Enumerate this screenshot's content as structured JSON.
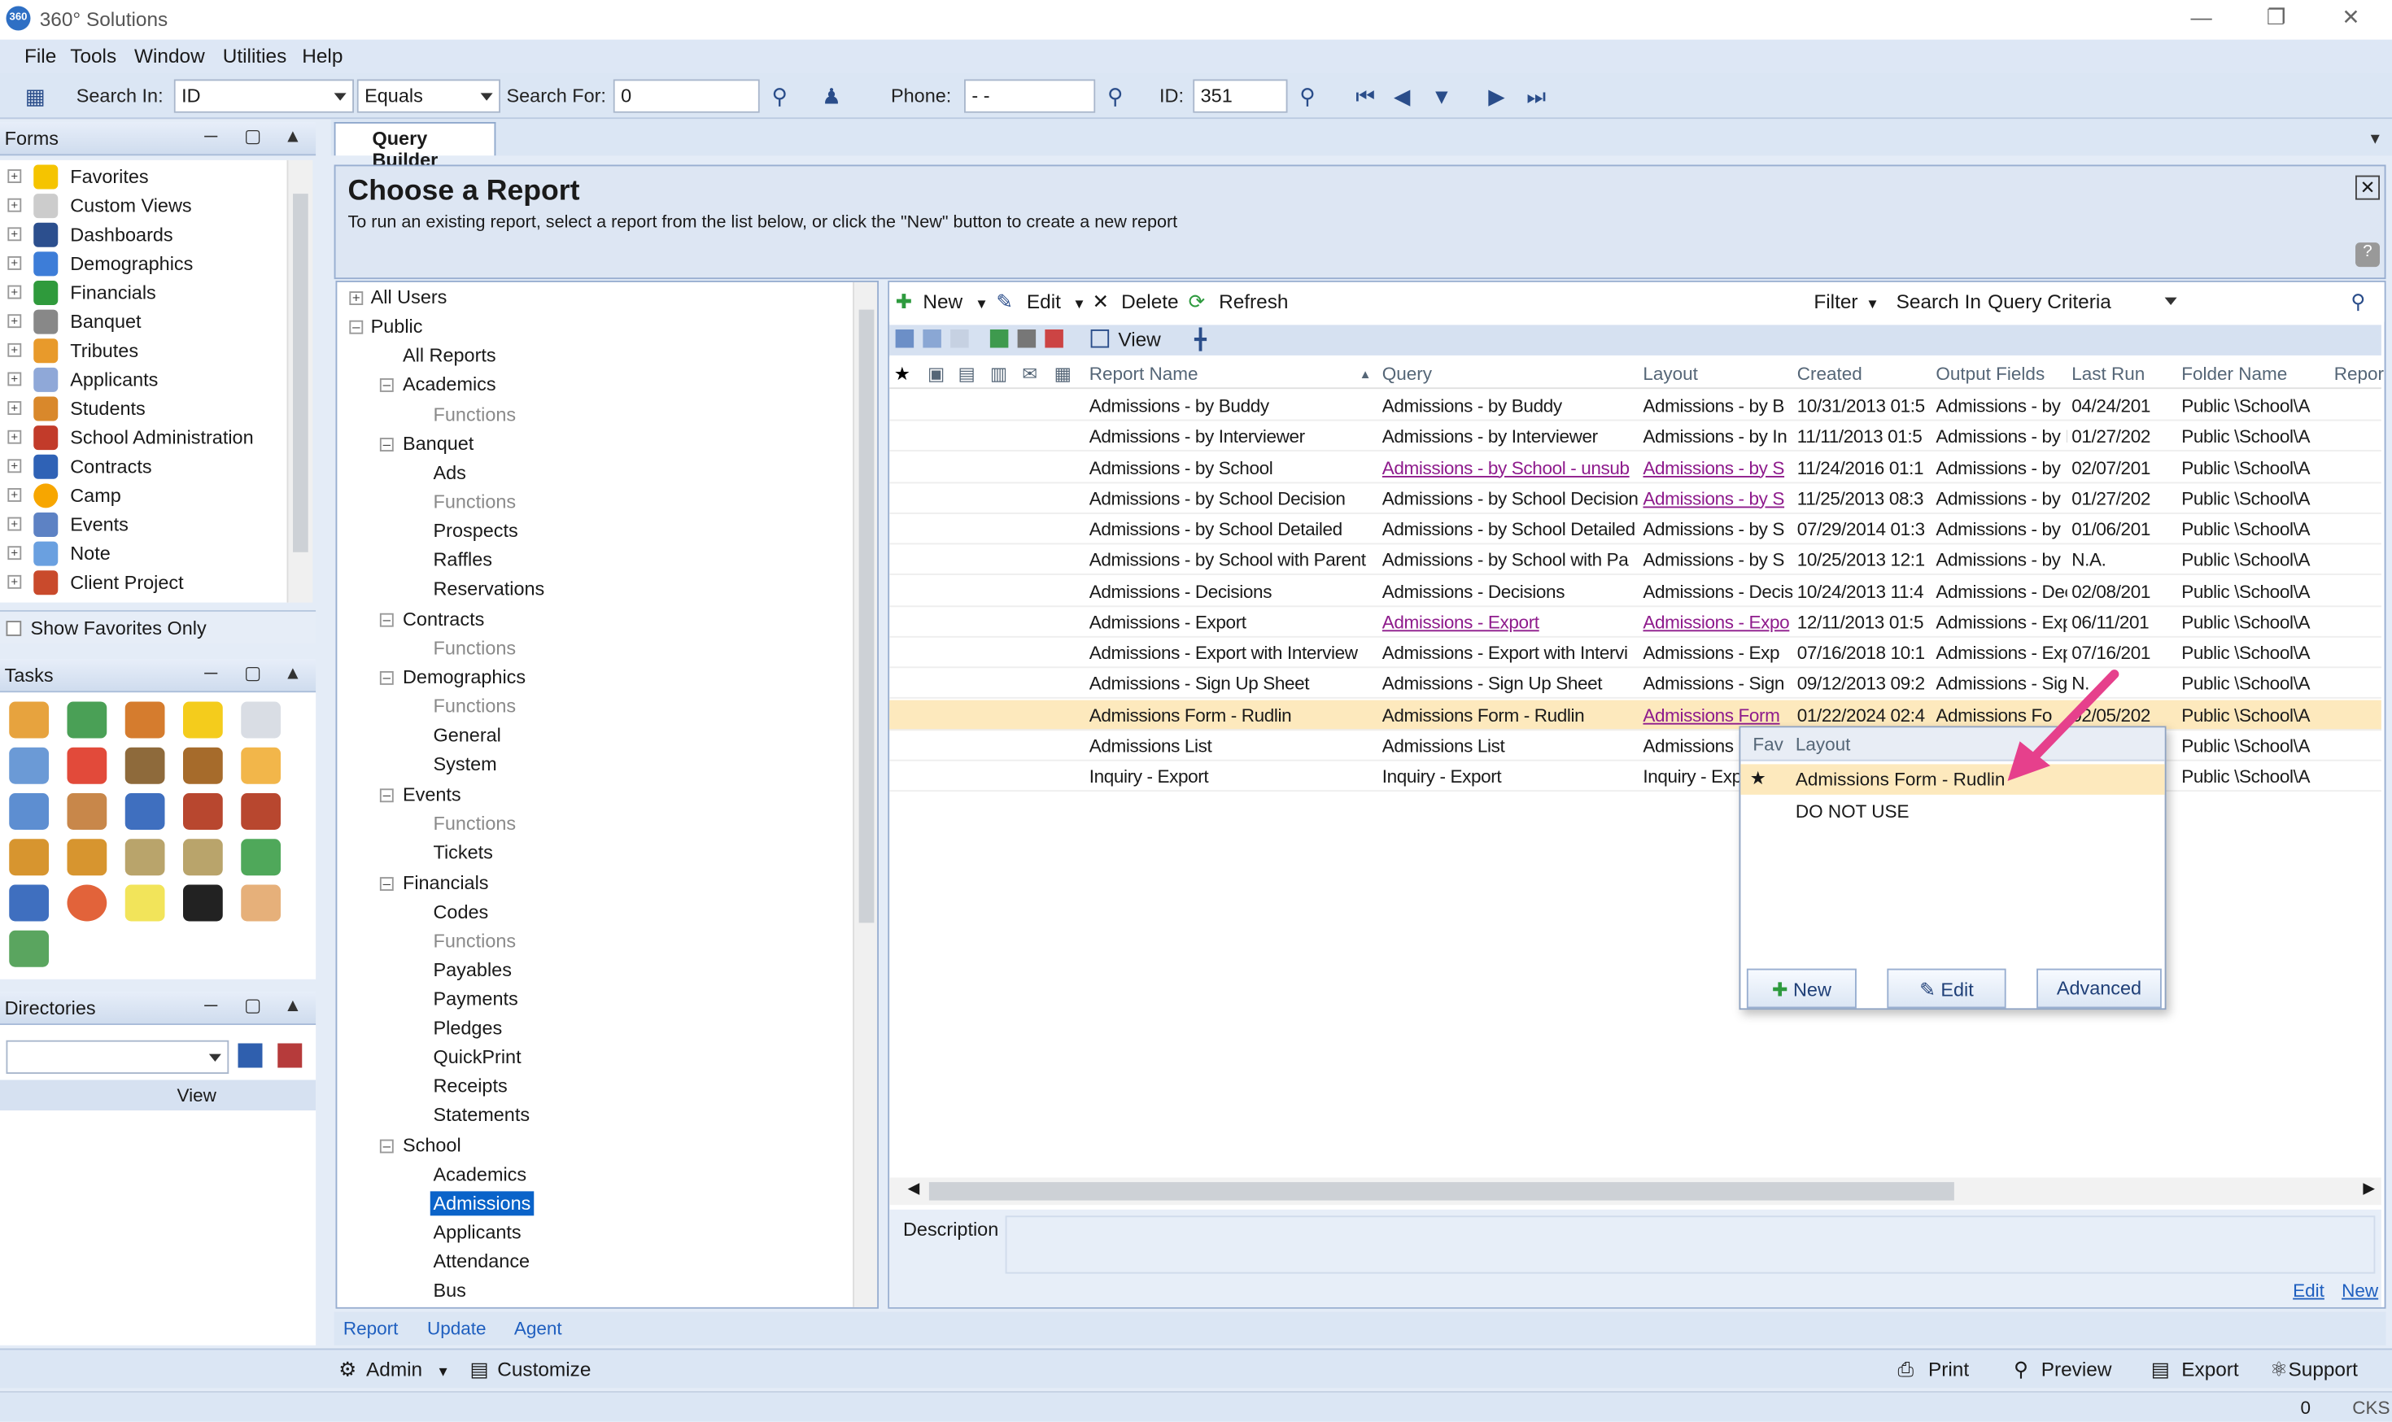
{
  "window": {
    "title": "360° Solutions"
  },
  "menu": [
    "File",
    "Tools",
    "Window",
    "Utilities",
    "Help"
  ],
  "toolbar": {
    "search_in_label": "Search In:",
    "search_in_value": "ID",
    "op_value": "Equals",
    "search_for_label": "Search For:",
    "search_for_value": "0",
    "phone_label": "Phone:",
    "phone_value": "-   -",
    "id_label": "ID:",
    "id_value": "351"
  },
  "forms": {
    "title": "Forms",
    "items": [
      "Favorites",
      "Custom Views",
      "Dashboards",
      "Demographics",
      "Financials",
      "Banquet",
      "Tributes",
      "Applicants",
      "Students",
      "School Administration",
      "Contracts",
      "Camp",
      "Events",
      "Note",
      "Client Project"
    ],
    "show_favorites": "Show Favorites Only"
  },
  "tasks": {
    "title": "Tasks"
  },
  "directories": {
    "title": "Directories",
    "view": "View"
  },
  "tab": {
    "label": "Query Builder"
  },
  "header": {
    "title": "Choose a Report",
    "subtitle": "To run an existing report, select a report from the list below, or click the \"New\" button to create a new report"
  },
  "tree": [
    "All Users",
    "Public",
    "All Reports",
    "Academics",
    "Functions",
    "Banquet",
    "Ads",
    "Functions",
    "Prospects",
    "Raffles",
    "Reservations",
    "Contracts",
    "Functions",
    "Demographics",
    "Functions",
    "General",
    "System",
    "Events",
    "Functions",
    "Tickets",
    "Financials",
    "Codes",
    "Functions",
    "Payables",
    "Payments",
    "Pledges",
    "QuickPrint",
    "Receipts",
    "Statements",
    "School",
    "Academics",
    "Admissions",
    "Applicants",
    "Attendance",
    "Bus"
  ],
  "grid_toolbar": {
    "new": "New",
    "edit": "Edit",
    "delete": "Delete",
    "refresh": "Refresh",
    "filter": "Filter",
    "search_in": "Search In",
    "criteria": "Query Criteria",
    "view": "View"
  },
  "columns": [
    "Report Name",
    "Query",
    "Layout",
    "Created",
    "Output Fields",
    "Last Run",
    "Folder Name",
    "Repor"
  ],
  "rows": [
    [
      "Admissions - by Buddy",
      "Admissions - by Buddy",
      "Admissions - by B",
      "10/31/2013 01:5",
      "Admissions - by",
      "04/24/201",
      "Public \\School\\A"
    ],
    [
      "Admissions - by Interviewer",
      "Admissions - by Interviewer",
      "Admissions - by In",
      "11/11/2013 01:5",
      "Admissions - by I",
      "01/27/202",
      "Public \\School\\A"
    ],
    [
      "Admissions - by School",
      "Admissions - by School - unsub",
      "Admissions - by S",
      "11/24/2016 01:1",
      "Admissions - by",
      "02/07/201",
      "Public \\School\\A"
    ],
    [
      "Admissions - by School Decision",
      "Admissions - by School Decision",
      "Admissions - by S",
      "11/25/2013 08:3",
      "Admissions - by",
      "01/27/202",
      "Public \\School\\A"
    ],
    [
      "Admissions - by School Detailed",
      "Admissions - by School Detailed",
      "Admissions - by S",
      "07/29/2014 01:3",
      "Admissions - by",
      "01/06/201",
      "Public \\School\\A"
    ],
    [
      "Admissions - by School with Parent",
      "Admissions - by School with Pa",
      "Admissions - by S",
      "10/25/2013 12:1",
      "Admissions - by",
      "N.A.",
      "Public \\School\\A"
    ],
    [
      "Admissions - Decisions",
      "Admissions - Decisions",
      "Admissions - Decis",
      "10/24/2013 11:4",
      "Admissions - Dec",
      "02/08/201",
      "Public \\School\\A"
    ],
    [
      "Admissions - Export",
      "Admissions - Export",
      "Admissions - Expo",
      "12/11/2013 01:5",
      "Admissions - Exp",
      "06/11/201",
      "Public \\School\\A"
    ],
    [
      "Admissions - Export with Interview",
      "Admissions - Export with Intervi",
      "Admissions - Exp",
      "07/16/2018 10:1",
      "Admissions - Exp",
      "07/16/201",
      "Public \\School\\A"
    ],
    [
      "Admissions - Sign Up Sheet",
      "Admissions - Sign Up Sheet",
      "Admissions - Sign",
      "09/12/2013 09:2",
      "Admissions - Sig",
      "N.",
      "Public \\School\\A"
    ],
    [
      "Admissions Form - Rudlin",
      "Admissions Form - Rudlin",
      "Admissions Form",
      "01/22/2024 02:4",
      "Admissions Fo",
      "02/05/202",
      "Public \\School\\A"
    ],
    [
      "Admissions List",
      "Admissions List",
      "Admissions",
      "",
      "",
      "",
      "Public \\School\\A"
    ],
    [
      "Inquiry - Export",
      "Inquiry - Export",
      "Inquiry - Exp",
      "",
      "",
      "",
      "Public \\School\\A"
    ]
  ],
  "popup": {
    "col_fav": "Fav",
    "col_layout": "Layout",
    "items": [
      "Admissions Form - Rudlin",
      "DO NOT USE"
    ],
    "new": "New",
    "edit": "Edit",
    "advanced": "Advanced"
  },
  "description": {
    "label": "Description",
    "edit": "Edit",
    "new": "New"
  },
  "bottom_tabs": [
    "Report",
    "Update",
    "Agent"
  ],
  "status": {
    "admin": "Admin",
    "customize": "Customize",
    "print": "Print",
    "preview": "Preview",
    "export": "Export",
    "support": "Support",
    "count": "0",
    "cks": "CKS"
  },
  "colors": {
    "accent": "#1f5fbf",
    "selected_row": "#fde9bd",
    "link": "#8e1b8c",
    "arrow": "#e6408c"
  }
}
